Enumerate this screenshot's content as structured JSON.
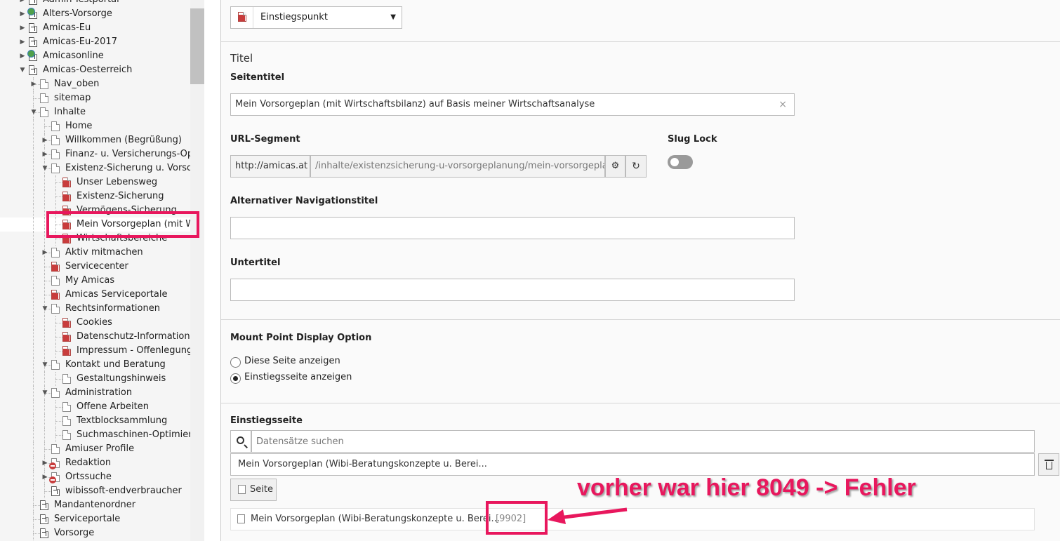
{
  "tree": {
    "items": [
      {
        "label": "Admin-Testportal",
        "depth": 0,
        "toggle": "right",
        "icon": "mount"
      },
      {
        "label": "Alters-Vorsorge",
        "depth": 0,
        "toggle": "right",
        "icon": "globe"
      },
      {
        "label": "Amicas-Eu",
        "depth": 0,
        "toggle": "right",
        "icon": "mount"
      },
      {
        "label": "Amicas-Eu-2017",
        "depth": 0,
        "toggle": "right",
        "icon": "mount"
      },
      {
        "label": "Amicasonline",
        "depth": 0,
        "toggle": "right",
        "icon": "globe"
      },
      {
        "label": "Amicas-Oesterreich",
        "depth": 0,
        "toggle": "down",
        "icon": "mount"
      },
      {
        "label": "Nav_oben",
        "depth": 1,
        "toggle": "right",
        "icon": "page"
      },
      {
        "label": "sitemap",
        "depth": 1,
        "toggle": "",
        "icon": "page"
      },
      {
        "label": "Inhalte",
        "depth": 1,
        "toggle": "down",
        "icon": "page"
      },
      {
        "label": "Home",
        "depth": 2,
        "toggle": "",
        "icon": "page"
      },
      {
        "label": "Willkommen (Begrüßung)",
        "depth": 2,
        "toggle": "right",
        "icon": "page"
      },
      {
        "label": "Finanz- u. Versicherungs-Op",
        "depth": 2,
        "toggle": "right",
        "icon": "page"
      },
      {
        "label": "Existenz-Sicherung u. Vorsor",
        "depth": 2,
        "toggle": "down",
        "icon": "page"
      },
      {
        "label": "Unser Lebensweg",
        "depth": 3,
        "toggle": "",
        "icon": "shortcut"
      },
      {
        "label": "Existenz-Sicherung",
        "depth": 3,
        "toggle": "",
        "icon": "shortcut"
      },
      {
        "label": "Vermögens-Sicherung",
        "depth": 3,
        "toggle": "",
        "icon": "shortcut"
      },
      {
        "label": "Mein Vorsorgeplan (mit W",
        "depth": 3,
        "toggle": "",
        "icon": "shortcut",
        "selected": true
      },
      {
        "label": "Wirtschaftsbereiche",
        "depth": 3,
        "toggle": "",
        "icon": "shortcut"
      },
      {
        "label": "Aktiv mitmachen",
        "depth": 2,
        "toggle": "right",
        "icon": "page"
      },
      {
        "label": "Servicecenter",
        "depth": 2,
        "toggle": "",
        "icon": "shortcut"
      },
      {
        "label": "My Amicas",
        "depth": 2,
        "toggle": "",
        "icon": "page"
      },
      {
        "label": "Amicas Serviceportale",
        "depth": 2,
        "toggle": "",
        "icon": "shortcut"
      },
      {
        "label": "Rechtsinformationen",
        "depth": 2,
        "toggle": "down",
        "icon": "page"
      },
      {
        "label": "Cookies",
        "depth": 3,
        "toggle": "",
        "icon": "shortcut"
      },
      {
        "label": "Datenschutz-Information",
        "depth": 3,
        "toggle": "",
        "icon": "shortcut"
      },
      {
        "label": "Impressum - Offenlegung",
        "depth": 3,
        "toggle": "",
        "icon": "shortcut"
      },
      {
        "label": "Kontakt und Beratung",
        "depth": 2,
        "toggle": "down",
        "icon": "page"
      },
      {
        "label": "Gestaltungshinweis",
        "depth": 3,
        "toggle": "",
        "icon": "page"
      },
      {
        "label": "Administration",
        "depth": 2,
        "toggle": "down",
        "icon": "page"
      },
      {
        "label": "Offene Arbeiten",
        "depth": 3,
        "toggle": "",
        "icon": "page"
      },
      {
        "label": "Textblocksammlung",
        "depth": 3,
        "toggle": "",
        "icon": "page"
      },
      {
        "label": "Suchmaschinen-Optimieru",
        "depth": 3,
        "toggle": "",
        "icon": "page"
      },
      {
        "label": "Amiuser Profile",
        "depth": 2,
        "toggle": "",
        "icon": "page"
      },
      {
        "label": "Redaktion",
        "depth": 2,
        "toggle": "right",
        "icon": "page-red"
      },
      {
        "label": "Ortssuche",
        "depth": 2,
        "toggle": "right",
        "icon": "page-red"
      },
      {
        "label": "wibissoft-endverbraucher",
        "depth": 2,
        "toggle": "",
        "icon": "mount"
      },
      {
        "label": "Mandantenordner",
        "depth": 1,
        "toggle": "",
        "icon": "mount"
      },
      {
        "label": "Serviceportale",
        "depth": 1,
        "toggle": "",
        "icon": "mount"
      },
      {
        "label": "Vorsorge",
        "depth": 1,
        "toggle": "",
        "icon": "mount"
      }
    ]
  },
  "form": {
    "doktype_value": "Einstiegspunkt",
    "section_title": "Titel",
    "seitentitel_label": "Seitentitel",
    "seitentitel_value": "Mein Vorsorgeplan (mit Wirtschaftsbilanz) auf Basis meiner Wirtschaftsanalyse",
    "clear_glyph": "×",
    "url_segment_label": "URL-Segment",
    "url_prefix": "http://amicas.at",
    "url_value": "/inhalte/existenzsicherung-u-vorsorgeplanung/mein-vorsorgepla",
    "slug_lock_label": "Slug Lock",
    "alt_nav_label": "Alternativer Navigationstitel",
    "alt_nav_value": "",
    "untertitel_label": "Untertitel",
    "untertitel_value": "",
    "mount_display_label": "Mount Point Display Option",
    "radio_options": [
      "Diese Seite anzeigen",
      "Einstiegsseite anzeigen"
    ],
    "radio_selected": 1,
    "einstiegsseite_label": "Einstiegsseite",
    "search_placeholder": "Datensätze suchen",
    "selected_record": "Mein Vorsorgeplan (Wibi-Beratungskonzepte u. Berei...",
    "seite_button": "Seite",
    "record_title": "Mein Vorsorgeplan (Wibi-Beratungskonzepte u. Berei...",
    "record_id": "[9902]"
  },
  "annotation": {
    "text": "vorher war hier 8049 -> Fehler",
    "color": "#e8175d"
  },
  "colors": {
    "tree_bg": "#f5f5f5",
    "form_bg": "#fafafa",
    "shortcut_red": "#c83c3c"
  }
}
